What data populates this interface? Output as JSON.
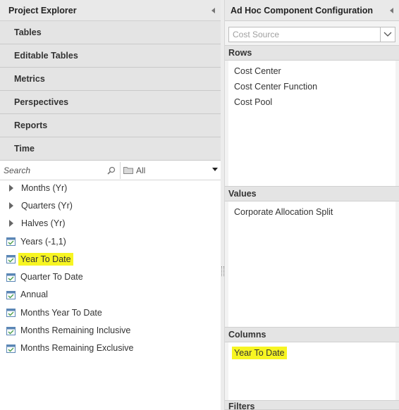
{
  "left_panel": {
    "title": "Project Explorer",
    "nav": [
      "Tables",
      "Editable Tables",
      "Metrics",
      "Perspectives",
      "Reports",
      "Time"
    ],
    "search": {
      "placeholder": "Search"
    },
    "filter_label": "All",
    "tree": [
      {
        "label": "Months (Yr)",
        "icon": "expand-caret-icon",
        "highlighted": false
      },
      {
        "label": "Quarters (Yr)",
        "icon": "expand-caret-icon",
        "highlighted": false
      },
      {
        "label": "Halves (Yr)",
        "icon": "expand-caret-icon",
        "highlighted": false
      },
      {
        "label": "Years (-1,1)",
        "icon": "calendar-icon",
        "highlighted": false
      },
      {
        "label": "Year To Date",
        "icon": "calendar-icon",
        "highlighted": true
      },
      {
        "label": "Quarter To Date",
        "icon": "calendar-icon",
        "highlighted": false
      },
      {
        "label": "Annual",
        "icon": "calendar-icon",
        "highlighted": false
      },
      {
        "label": "Months Year To Date",
        "icon": "calendar-icon",
        "highlighted": false
      },
      {
        "label": "Months Remaining Inclusive",
        "icon": "calendar-icon",
        "highlighted": false
      },
      {
        "label": "Months Remaining Exclusive",
        "icon": "calendar-icon",
        "highlighted": false
      }
    ]
  },
  "right_panel": {
    "title": "Ad Hoc Component Configuration",
    "source_select": {
      "placeholder": "Cost Source"
    },
    "sections": {
      "rows": {
        "label": "Rows",
        "items": [
          "Cost Center",
          "Cost Center Function",
          "Cost Pool"
        ]
      },
      "values": {
        "label": "Values",
        "items": [
          "Corporate Allocation Split"
        ]
      },
      "columns": {
        "label": "Columns",
        "items": [
          "Year To Date"
        ]
      },
      "filters": {
        "label": "Filters"
      }
    }
  },
  "colors": {
    "highlight": "#f7f522",
    "header_bg": "#e9e9e9",
    "nav_bg": "#e4e4e4"
  }
}
